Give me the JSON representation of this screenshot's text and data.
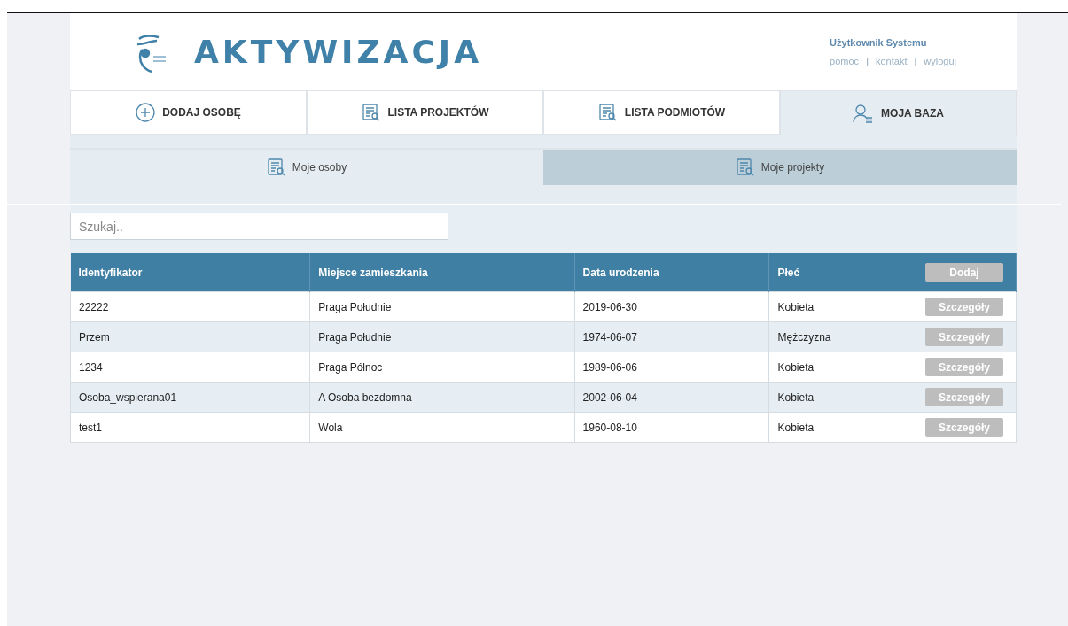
{
  "header": {
    "logo_text": "AKTYWIZACJA",
    "user": "Użytkownik Systemu",
    "links": [
      {
        "kind": "link",
        "text": "pomoc"
      },
      {
        "kind": "separator",
        "text": "|"
      },
      {
        "kind": "link",
        "text": "kontakt"
      },
      {
        "kind": "separator",
        "text": "|"
      },
      {
        "kind": "link",
        "text": "wyloguj"
      }
    ]
  },
  "nav_tabs": [
    {
      "label": "DODAJ OSOBĘ",
      "kind": "add",
      "selected": false
    },
    {
      "label": "LISTA PROJEKTÓW",
      "kind": "list",
      "selected": false
    },
    {
      "label": "LISTA PODMIOTÓW",
      "kind": "list",
      "selected": false
    },
    {
      "label": "MOJA BAZA",
      "kind": "base",
      "selected": true
    }
  ],
  "sub_tabs": [
    {
      "label": "Moje osoby",
      "selected": true
    },
    {
      "label": "Moje projekty",
      "selected": false
    }
  ],
  "search": {
    "placeholder": "Szukaj.."
  },
  "table": {
    "columns": [
      "Identyfikator",
      "Miejsce zamieszkania",
      "Data urodzenia",
      "Płeć"
    ],
    "add_button": "Dodaj",
    "rows": [
      {
        "cells": [
          "22222",
          "Praga Południe",
          "2019-06-30",
          "Kobieta"
        ],
        "button": "Szczegóły"
      },
      {
        "cells": [
          "Przem",
          "Praga Południe",
          "1974-06-07",
          "Mężczyzna"
        ],
        "button": "Szczegóły"
      },
      {
        "cells": [
          "1234",
          "Praga Północ",
          "1989-06-06",
          "Kobieta"
        ],
        "button": "Szczegóły"
      },
      {
        "cells": [
          "Osoba_wspierana01",
          "A Osoba bezdomna",
          "2002-06-04",
          "Kobieta"
        ],
        "button": "Szczegóły"
      },
      {
        "cells": [
          "test1",
          "Wola",
          "1960-08-10",
          "Kobieta"
        ],
        "button": "Szczegóły"
      }
    ]
  }
}
